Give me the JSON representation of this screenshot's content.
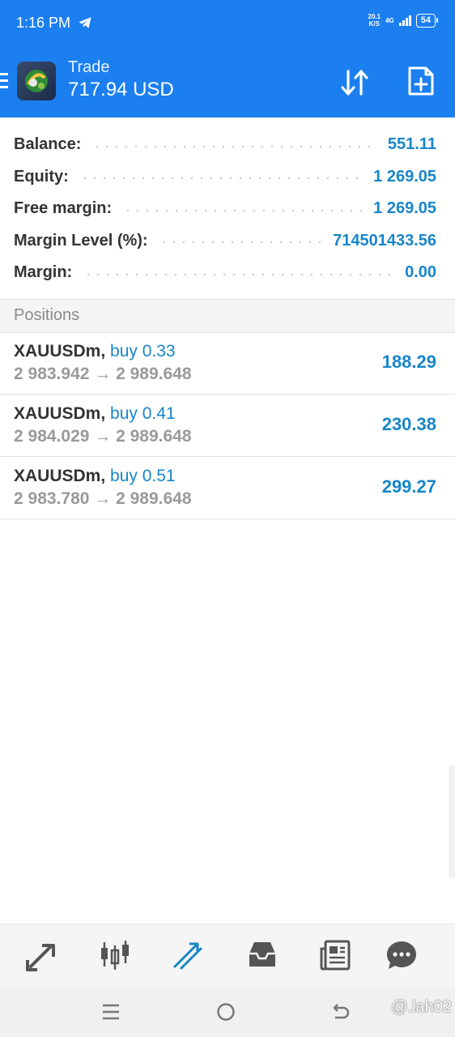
{
  "status_bar": {
    "time": "1:16 PM",
    "net_speed_top": "20.1",
    "net_speed_bottom": "K/S",
    "net_type": "4G",
    "battery": "54"
  },
  "header": {
    "title": "Trade",
    "balance": "717.94 USD"
  },
  "summary": {
    "rows": [
      {
        "label": "Balance:",
        "value": "551.11"
      },
      {
        "label": "Equity:",
        "value": "1 269.05"
      },
      {
        "label": "Free margin:",
        "value": "1 269.05"
      },
      {
        "label": "Margin Level (%):",
        "value": "714501433.56"
      },
      {
        "label": "Margin:",
        "value": "0.00"
      }
    ]
  },
  "positions": {
    "title": "Positions",
    "items": [
      {
        "symbol": "XAUUSDm,",
        "side": "buy 0.33",
        "prices": "2 983.942 → 2 989.648",
        "profit": "188.29"
      },
      {
        "symbol": "XAUUSDm,",
        "side": "buy 0.41",
        "prices": "2 984.029 → 2 989.648",
        "profit": "230.38"
      },
      {
        "symbol": "XAUUSDm,",
        "side": "buy 0.51",
        "prices": "2 983.780 → 2 989.648",
        "profit": "299.27"
      }
    ]
  },
  "bottom_nav": {
    "items": [
      "quotes-icon",
      "chart-icon",
      "trade-icon",
      "history-icon",
      "news-icon",
      "messages-icon"
    ],
    "active": "trade-icon"
  },
  "watermark": "@.lah02",
  "colors": {
    "header": "#1b7ff0",
    "accent": "#1786c9"
  }
}
